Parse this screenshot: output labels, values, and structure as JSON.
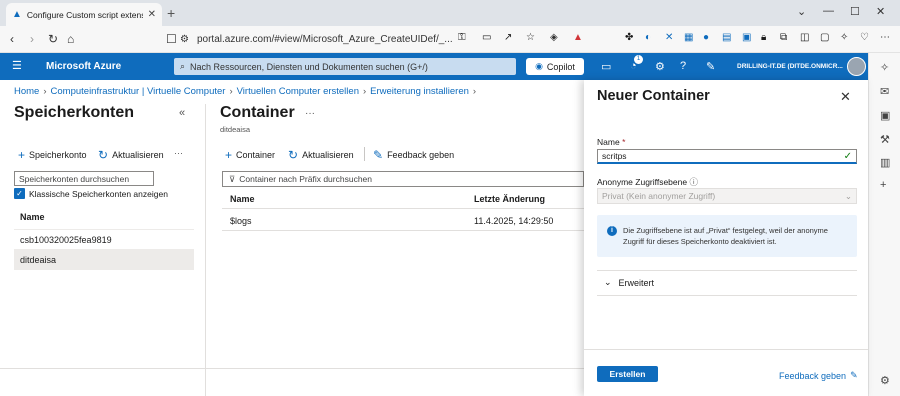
{
  "browser": {
    "tab_title": "Configure Custom script extens",
    "url": "portal.azure.com/#view/Microsoft_Azure_CreateUIDef/_..."
  },
  "azure_header": {
    "brand": "Microsoft Azure",
    "search_placeholder": "Nach Ressourcen, Diensten und Dokumenten suchen (G+/)",
    "copilot_label": "Copilot",
    "notification_count": "1",
    "tenant": "DRILLING-IT.DE (DITDE.ONMICR..."
  },
  "breadcrumb": [
    "Home",
    "Computeinfrastruktur | Virtuelle Computer",
    "Virtuellen Computer erstellen",
    "Erweiterung installieren"
  ],
  "left_pane": {
    "title": "Speicherkonten",
    "add_label": "Speicherkonto",
    "refresh_label": "Aktualisieren",
    "more_label": "···",
    "search_placeholder": "Speicherkonten durchsuchen",
    "checkbox_label": "Klassische Speicherkonten anzeigen",
    "column_name": "Name",
    "accounts": [
      "csb100320025fea9819",
      "ditdeaisa"
    ]
  },
  "middle_pane": {
    "title": "Container",
    "more_label": "···",
    "subtitle": "ditdeaisa",
    "add_label": "Container",
    "refresh_label": "Aktualisieren",
    "feedback_label": "Feedback geben",
    "filter_placeholder": "Container nach Präfix durchsuchen",
    "columns": [
      "Name",
      "Letzte Änderung"
    ],
    "rows": [
      {
        "name": "$logs",
        "modified": "11.4.2025, 14:29:50"
      }
    ]
  },
  "panel": {
    "title": "Neuer Container",
    "name_label": "Name",
    "required_mark": "*",
    "name_value": "scritps",
    "access_label": "Anonyme Zugriffsebene",
    "access_value": "Privat (Kein anonymer Zugriff)",
    "info_text": "Die Zugriffsebene ist auf „Privat“ festgelegt, weil der anonyme Zugriff für dieses Speicherkonto deaktiviert ist.",
    "advanced_label": "Erweitert",
    "create_label": "Erstellen",
    "feedback_label": "Feedback geben"
  },
  "colors": {
    "accent": "#0f6cbd",
    "header_bg": "#0f6cbd",
    "valid_check": "#107c10"
  }
}
